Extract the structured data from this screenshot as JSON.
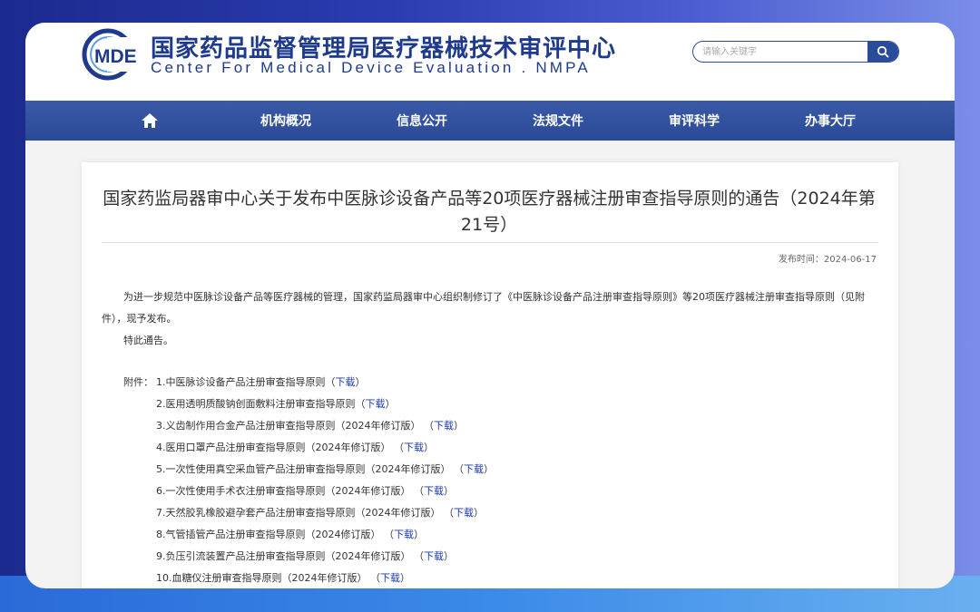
{
  "header": {
    "logo_abbr": "MDE",
    "title_cn": "国家药品监督管理局医疗器械技术审评中心",
    "title_en": "Center For Medical Device Evaluation . NMPA",
    "search_placeholder": "请输入关键字"
  },
  "nav": {
    "items": [
      "机构概况",
      "信息公开",
      "法规文件",
      "审评科学",
      "办事大厅"
    ]
  },
  "article": {
    "title": "国家药监局器审中心关于发布中医脉诊设备产品等20项医疗器械注册审查指导原则的通告（2024年第21号）",
    "publish_label": "发布时间：2024-06-17",
    "body": "为进一步规范中医脉诊设备产品等医疗器械的管理，国家药监局器审中心组织制修订了《中医脉诊设备产品注册审查指导原则》等20项医疗器械注册审查指导原则（见附件），现予发布。",
    "notice": "特此通告。",
    "attachment_label": "附件：",
    "download_text": "下载",
    "attachments": [
      "1.中医脉诊设备产品注册审查指导原则",
      "2.医用透明质酸钠创面敷料注册审查指导原则",
      "3.义齿制作用合金产品注册审查指导原则（2024年修订版）",
      "4.医用口罩产品注册审查指导原则（2024年修订版）",
      "5.一次性使用真空采血管产品注册审查指导原则（2024年修订版）",
      "6.一次性使用手术衣注册审查指导原则（2024年修订版）",
      "7.天然胶乳橡胶避孕套产品注册审查指导原则（2024年修订版）",
      "8.气管插管产品注册审查指导原则（2024修订版）",
      "9.负压引流装置产品注册审查指导原则（2024年修订版）",
      "10.血糖仪注册审查指导原则（2024年修订版）"
    ]
  },
  "colors": {
    "brand": "#1e3a8c",
    "nav_bg": "#2a4a98",
    "link": "#1a3ab0"
  }
}
